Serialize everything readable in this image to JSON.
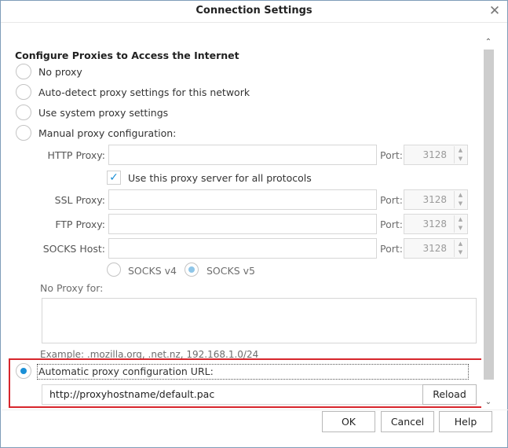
{
  "window": {
    "title": "Connection Settings",
    "close_glyph": "✕"
  },
  "section_title": "Configure Proxies to Access the Internet",
  "proxy_modes": [
    {
      "label": "No proxy",
      "checked": false
    },
    {
      "label": "Auto-detect proxy settings for this network",
      "checked": false
    },
    {
      "label": "Use system proxy settings",
      "checked": false
    },
    {
      "label": "Manual proxy configuration:",
      "checked": false
    },
    {
      "label": "Automatic proxy configuration URL:",
      "checked": true
    }
  ],
  "manual": {
    "http_label": "HTTP Proxy:",
    "ssl_label": "SSL Proxy:",
    "ftp_label": "FTP Proxy:",
    "socks_label": "SOCKS Host:",
    "port_label": "Port:",
    "http_value": "",
    "ssl_value": "",
    "ftp_value": "",
    "socks_value": "",
    "http_port": "3128",
    "ssl_port": "3128",
    "ftp_port": "3128",
    "socks_port": "3128",
    "use_for_all_label": "Use this proxy server for all protocols",
    "use_for_all_checked": true,
    "socks_v4_label": "SOCKS v4",
    "socks_v5_label": "SOCKS v5",
    "socks_version_selected": "v5"
  },
  "no_proxy": {
    "label": "No Proxy for:",
    "value": "",
    "example": "Example: .mozilla.org, .net.nz, 192.168.1.0/24"
  },
  "pac": {
    "url": "http://proxyhostname/default.pac",
    "reload_label": "Reload"
  },
  "buttons": {
    "ok": "OK",
    "cancel": "Cancel",
    "help": "Help"
  },
  "icons": {
    "close": "close-icon",
    "scroll_up": "chevron-up-icon",
    "scroll_down": "chevron-down-icon",
    "check": "checkmark-icon"
  },
  "colors": {
    "accent": "#1a8fd6",
    "highlight_border": "#d7262c"
  }
}
